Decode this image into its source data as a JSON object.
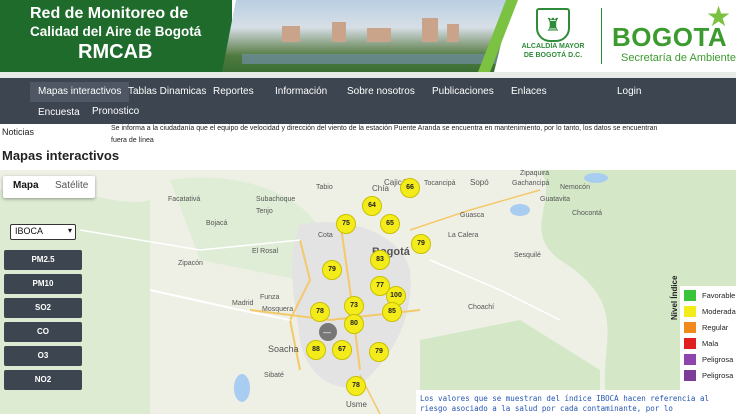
{
  "banner": {
    "title_line1": "Red de Monitoreo de",
    "title_line2": "Calidad del Aire de Bogotá",
    "title_line3": "RMCAB",
    "alcaldia_line1": "ALCALDÍA MAYOR",
    "alcaldia_line2": "DE BOGOTÁ D.C.",
    "bogota": "BOGOTA",
    "secretaria": "Secretaría de Ambiente"
  },
  "nav": {
    "items": [
      "Mapas interactivos",
      "Tablas Dinamicas",
      "Reportes",
      "Información",
      "Sobre nosotros",
      "Publicaciones",
      "Enlaces",
      "Login"
    ],
    "row2": [
      "Encuesta",
      "Pronostico"
    ]
  },
  "notice": {
    "label": "Noticias",
    "text": "Se informa a la ciudadanía que el equipo de velocidad y dirección del viento de la estación Puente Aranda se encuentra en mantenimiento, por lo tanto, los datos se encuentran fuera de línea"
  },
  "page_title": "Mapas interactivos",
  "map": {
    "toggle": [
      "Mapa",
      "Satélite"
    ],
    "index_select": "IBOCA",
    "pollutant_buttons": [
      "PM2.5",
      "PM10",
      "SO2",
      "CO",
      "O3",
      "NO2"
    ],
    "place_labels": [
      "Bogotá",
      "Soacha",
      "Chía",
      "Cajicá",
      "Sopó",
      "Tocancipá",
      "Gachancipá",
      "Tabio",
      "Tenjo",
      "Cota",
      "Funza",
      "Mosquera",
      "Madrid",
      "Facatativá",
      "Bojacá",
      "Zipacón",
      "El Rosal",
      "Subachoque",
      "Guasca",
      "La Calera",
      "Sesquilé",
      "Chocontá",
      "Choachí",
      "Sibaté",
      "Usme",
      "Guatavita",
      "Zipaquirá",
      "Nemocón"
    ],
    "station_values": [
      66,
      64,
      75,
      65,
      79,
      83,
      79,
      77,
      100,
      73,
      85,
      78,
      80,
      88,
      67,
      79,
      78
    ],
    "legend_title": "Nivel Índice",
    "legend": [
      {
        "label": "Favorable",
        "color": "#39c43a"
      },
      {
        "label": "Moderada",
        "color": "#f4ec1a"
      },
      {
        "label": "Regular",
        "color": "#f18a1c"
      },
      {
        "label": "Mala",
        "color": "#e02020"
      },
      {
        "label": "Peligrosa",
        "color": "#8e44ad"
      },
      {
        "label": "Peligrosa",
        "color": "#7d3c98"
      }
    ],
    "info_text": "Los valores que se muestran del índice IBOCA hacen referencia al riesgo asociado a la salud por cada contaminante, por lo"
  }
}
